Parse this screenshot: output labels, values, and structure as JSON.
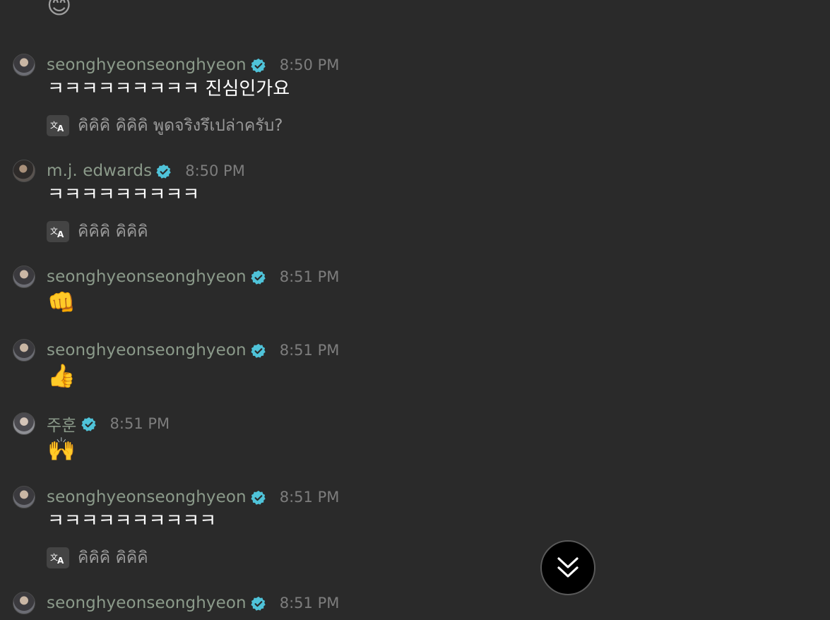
{
  "top_emoji": "😊",
  "translate_icon": "translate-icon",
  "verified_icon": "verified-badge-icon",
  "scroll_icon": "double-chevron-down-icon",
  "colors": {
    "background": "#2a2a2a",
    "username": "#8b9a8a",
    "timestamp": "#7d7d7d",
    "verified": "#4fc3d9",
    "translation_text": "#9a9a9a"
  },
  "messages": [
    {
      "username": "seonghyeonseonghyeon",
      "time": "8:50 PM",
      "text": "ㅋㅋㅋㅋㅋㅋㅋㅋㅋ 진심인가요",
      "translation": "คิคิคิ คิคิคิ พูดจริงรึเปล่าครับ?"
    },
    {
      "username": "m.j. edwards",
      "time": "8:50 PM",
      "text": "ㅋㅋㅋㅋㅋㅋㅋㅋㅋ",
      "translation": "คิคิคิ คิคิคิ"
    },
    {
      "username": "seonghyeonseonghyeon",
      "time": "8:51 PM",
      "emoji": "👊"
    },
    {
      "username": "seonghyeonseonghyeon",
      "time": "8:51 PM",
      "emoji": "👍"
    },
    {
      "username": "주훈",
      "time": "8:51 PM",
      "emoji": "🙌"
    },
    {
      "username": "seonghyeonseonghyeon",
      "time": "8:51 PM",
      "text": "ㅋㅋㅋㅋㅋㅋㅋㅋㅋㅋ",
      "translation": "คิคิคิ คิคิคิ"
    },
    {
      "username": "seonghyeonseonghyeon",
      "time": "8:51 PM"
    }
  ]
}
